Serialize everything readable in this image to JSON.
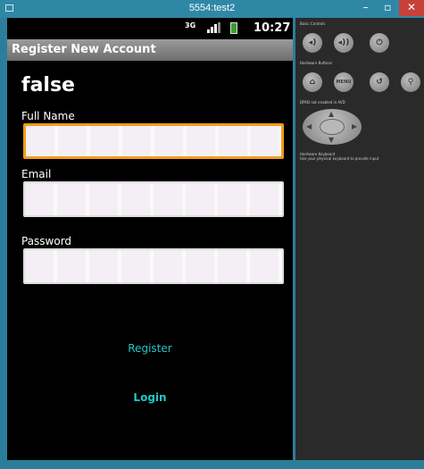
{
  "window": {
    "title": "5554:test2",
    "minimize_glyph": "–",
    "restore_glyph": "▫",
    "close_glyph": "✕"
  },
  "statusbar": {
    "network": "3G",
    "time": "10:27"
  },
  "app": {
    "title": "Register New Account",
    "result_text": "false",
    "full_name_label": "Full Name",
    "full_name_value": "",
    "email_label": "Email",
    "email_value": "",
    "password_label": "Password",
    "password_value": "",
    "register_label": "Register",
    "login_label": "Login",
    "accent_color": "#24c6c6",
    "focus_color": "#f39a1a"
  },
  "panel": {
    "basic_controls_title": "Basic Controls",
    "hardware_buttons_title": "Hardware Buttons",
    "menu_label": "MENU",
    "dpad_title": "DPAD not enabled in AVD",
    "keyboard_title": "Hardware Keyboard",
    "keyboard_note": "Use your physical keyboard to provide input"
  }
}
